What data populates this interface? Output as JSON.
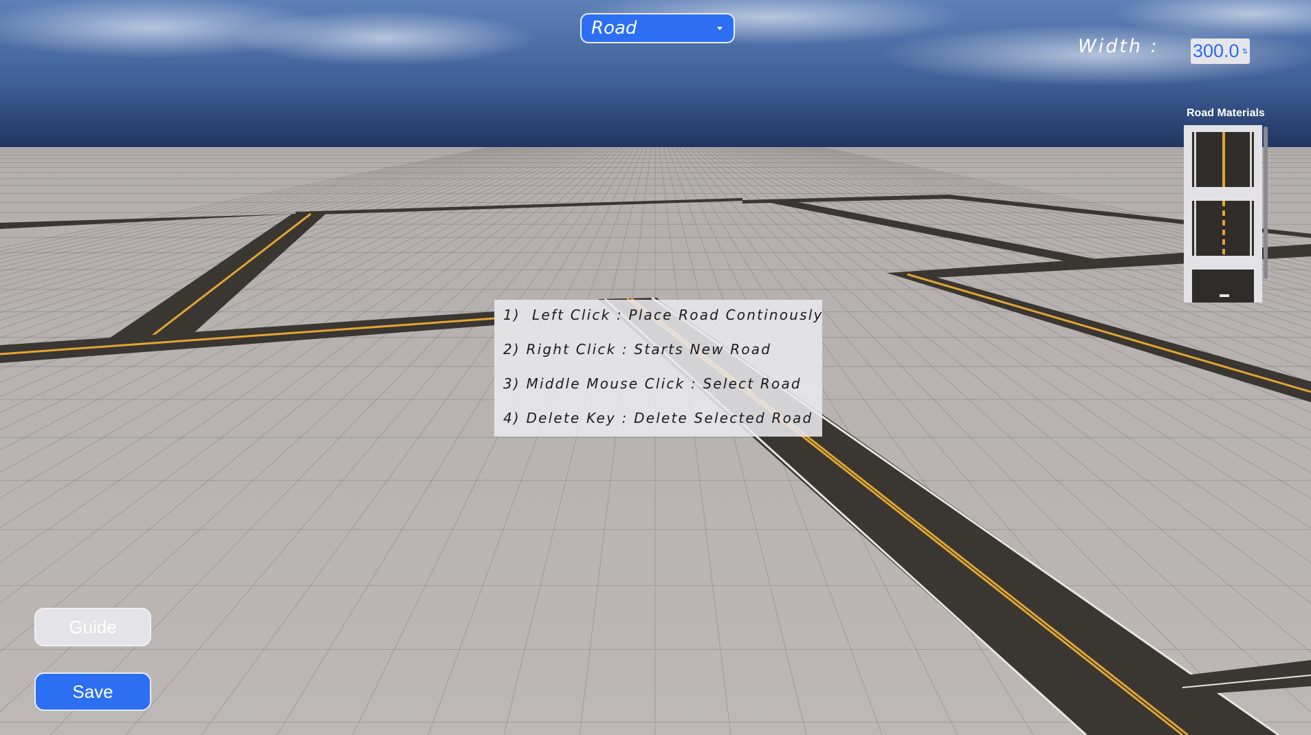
{
  "toolbar": {
    "mode_selected": "Road",
    "width_label": "Width :",
    "width_value": "300.0"
  },
  "materials": {
    "title": "Road Materials",
    "items": [
      {
        "name": "solid-yellow-line"
      },
      {
        "name": "dashed-yellow-line"
      },
      {
        "name": "plain-asphalt"
      }
    ]
  },
  "guide": {
    "lines": [
      "1)  Left Click : Place Road Continously",
      "2) Right Click : Starts New Road",
      "3) Middle Mouse Click : Select Road",
      "4) Delete Key : Delete Selected Road"
    ]
  },
  "buttons": {
    "guide_label": "Guide",
    "save_label": "Save"
  },
  "colors": {
    "accent": "#2d6ff2",
    "road_asphalt": "#3a3631",
    "road_yellow": "#e3a533"
  }
}
